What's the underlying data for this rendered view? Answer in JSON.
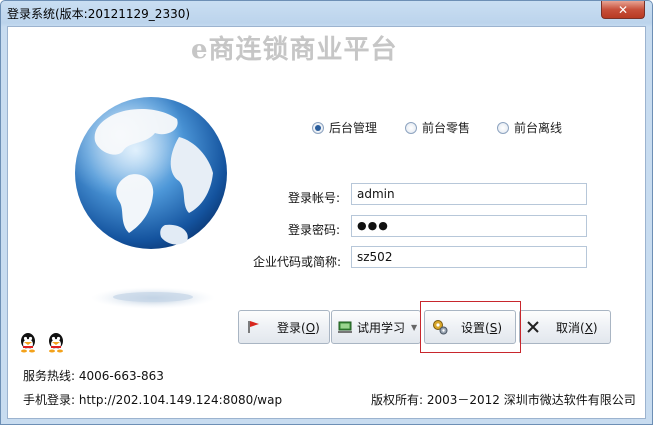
{
  "window": {
    "title": "登录系统(版本:20121129_2330)",
    "close_glyph": "✕"
  },
  "app": {
    "title": "e商连锁商业平台"
  },
  "mode": {
    "options": [
      {
        "label": "后台管理",
        "checked": true
      },
      {
        "label": "前台零售",
        "checked": false
      },
      {
        "label": "前台离线",
        "checked": false
      }
    ]
  },
  "form": {
    "account_label": "登录帐号:",
    "account_value": "admin",
    "password_label": "登录密码:",
    "password_value": "●●●",
    "company_label": "企业代码或简称:",
    "company_value": "sz502"
  },
  "buttons": {
    "login": {
      "label": "登录(",
      "hotkey": "O",
      "end": ")",
      "icon": "flag-icon"
    },
    "trial": {
      "label": "试用学习",
      "icon": "computer-icon"
    },
    "settings": {
      "label": "设置(",
      "hotkey": "S",
      "end": ")",
      "icon": "gears-icon"
    },
    "cancel": {
      "label": "取消(",
      "hotkey": "X",
      "end": ")",
      "icon": "x-icon"
    }
  },
  "footer": {
    "hotline": "服务热线: 4006-663-863",
    "mobile": "手机登录: http://202.104.149.124:8080/wap",
    "copyright": "版权所有: 2003－2012 深圳市微达软件有限公司"
  },
  "colors": {
    "accent_focus": "#c8272d",
    "title_gray": "#c6c6c6"
  }
}
